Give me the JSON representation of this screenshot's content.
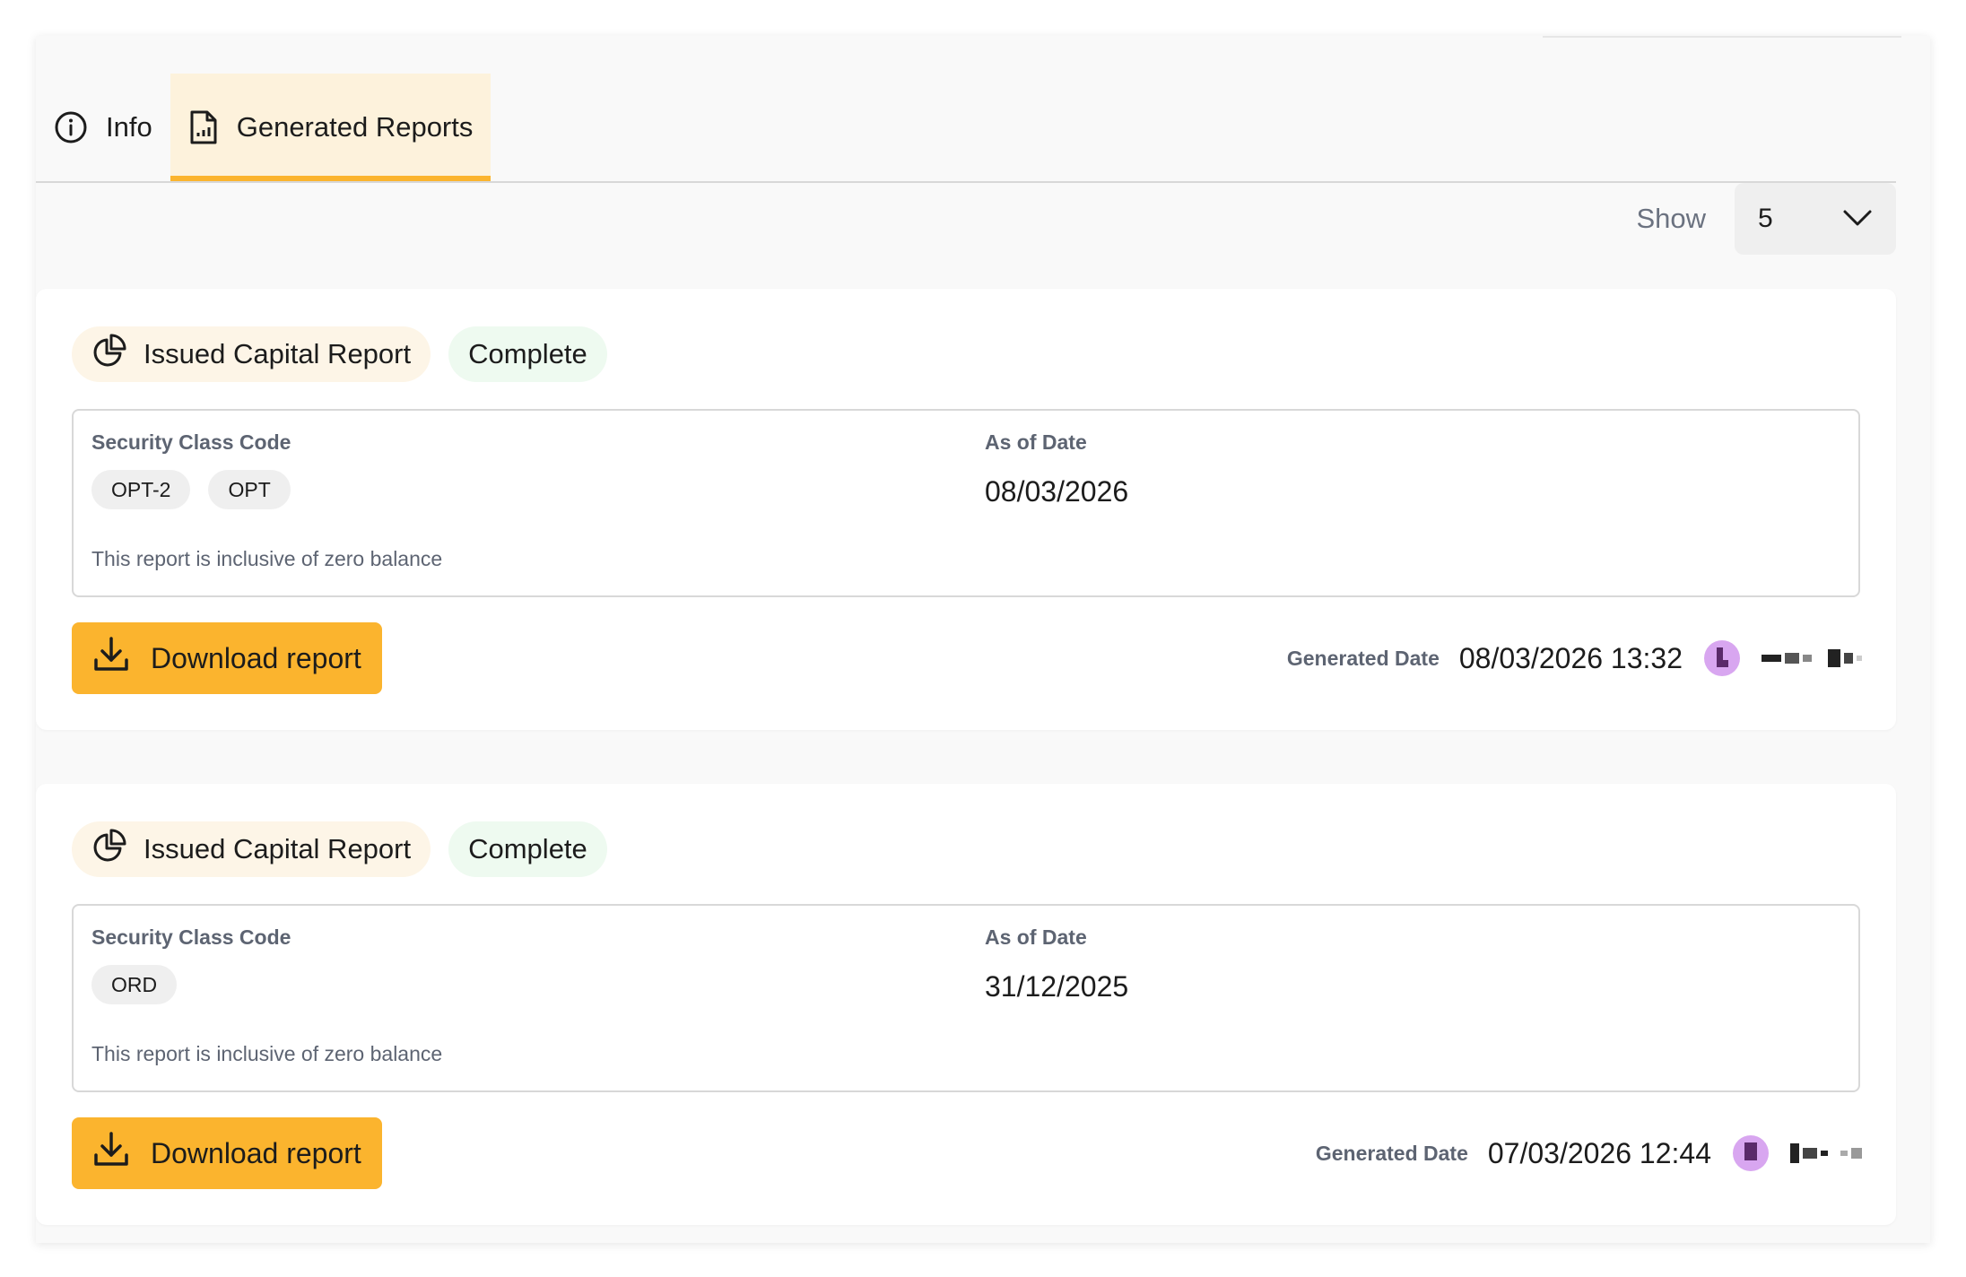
{
  "tabs": [
    {
      "label": "Info",
      "icon": "info-icon",
      "active": false
    },
    {
      "label": "Generated Reports",
      "icon": "report-file-icon",
      "active": true
    }
  ],
  "pagination": {
    "show_label": "Show",
    "page_size": "5"
  },
  "reports": [
    {
      "type_label": "Issued Capital Report",
      "status": "Complete",
      "security_class_label": "Security Class Code",
      "security_codes": [
        "OPT-2",
        "OPT"
      ],
      "as_of_label": "As of Date",
      "as_of_date": "08/03/2026",
      "note": "This report is inclusive of zero balance",
      "download_label": "Download report",
      "generated_label": "Generated Date",
      "generated_date": "08/03/2026 13:32"
    },
    {
      "type_label": "Issued Capital Report",
      "status": "Complete",
      "security_class_label": "Security Class Code",
      "security_codes": [
        "ORD"
      ],
      "as_of_label": "As of Date",
      "as_of_date": "31/12/2025",
      "note": "This report is inclusive of zero balance",
      "download_label": "Download report",
      "generated_label": "Generated Date",
      "generated_date": "07/03/2026 12:44"
    }
  ],
  "colors": {
    "accent": "#fbb42e",
    "active_tab_bg": "#fdf2dc",
    "status_bg": "#eefaf0",
    "avatar": "#d8a6f0"
  }
}
